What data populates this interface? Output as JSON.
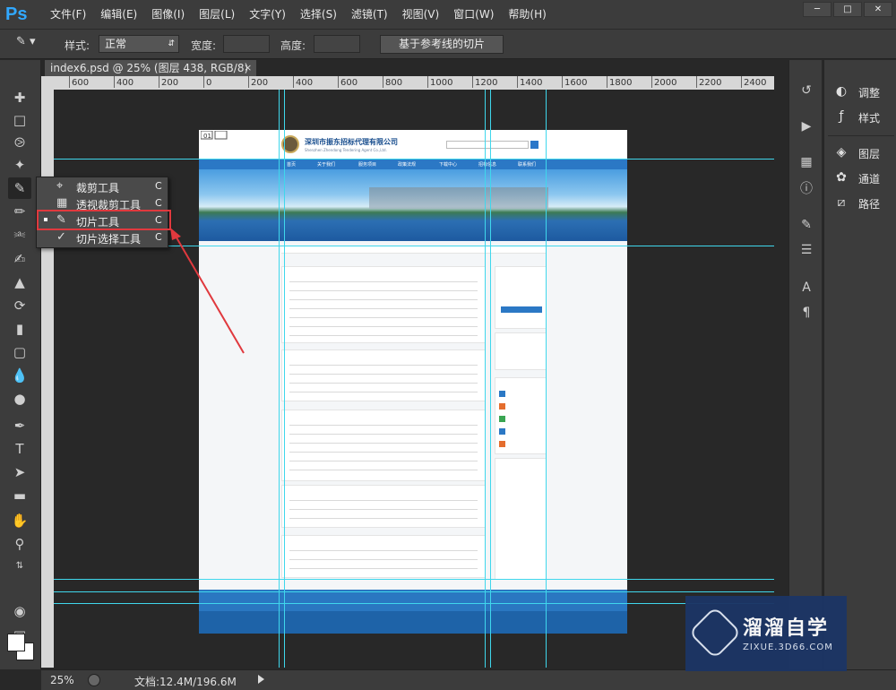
{
  "app": {
    "logo": "Ps",
    "menu": [
      "文件(F)",
      "编辑(E)",
      "图像(I)",
      "图层(L)",
      "文字(Y)",
      "选择(S)",
      "滤镜(T)",
      "视图(V)",
      "窗口(W)",
      "帮助(H)"
    ],
    "window_controls": [
      "minimize",
      "maximize",
      "close"
    ]
  },
  "options_bar": {
    "style_label": "样式:",
    "style_value": "正常",
    "width_label": "宽度:",
    "width_value": "",
    "height_label": "高度:",
    "height_value": "",
    "guides_slice_button": "基于参考线的切片"
  },
  "document": {
    "tab_title": "index6.psd @ 25% (图层 438, RGB/8) *",
    "tab_close": "×"
  },
  "ruler": {
    "ticks": [
      "600",
      "400",
      "200",
      "0",
      "200",
      "400",
      "600",
      "800",
      "1000",
      "1200",
      "1400",
      "1600",
      "1800",
      "2000",
      "2200",
      "2400"
    ]
  },
  "flyout": {
    "items": [
      {
        "icon": "crop-icon",
        "label": "裁剪工具",
        "shortcut": "C",
        "selected": false
      },
      {
        "icon": "perspective-crop-icon",
        "label": "透视裁剪工具",
        "shortcut": "C",
        "selected": false
      },
      {
        "icon": "slice-icon",
        "label": "切片工具",
        "shortcut": "C",
        "selected": true
      },
      {
        "icon": "slice-select-icon",
        "label": "切片选择工具",
        "shortcut": "C",
        "selected": false
      }
    ]
  },
  "tools": [
    "move-tool",
    "marquee-tool",
    "lasso-tool",
    "magic-wand-tool",
    "slice-tool",
    "eyedropper-tool",
    "healing-brush-tool",
    "brush-tool",
    "clone-stamp-tool",
    "history-brush-tool",
    "eraser-tool",
    "gradient-tool",
    "blur-tool",
    "dodge-tool",
    "pen-tool",
    "type-tool",
    "path-selection-tool",
    "rectangle-tool",
    "hand-tool",
    "zoom-tool"
  ],
  "panels": {
    "items": [
      {
        "icon": "adjustments-icon",
        "label": "调整"
      },
      {
        "icon": "styles-icon",
        "label": "样式"
      },
      {
        "icon": "layers-icon",
        "label": "图层"
      },
      {
        "icon": "channels-icon",
        "label": "通道"
      },
      {
        "icon": "paths-icon",
        "label": "路径"
      }
    ]
  },
  "status": {
    "zoom": "25%",
    "doc_size": "文档:12.4M/196.6M"
  },
  "website": {
    "company_cn": "深圳市振东招标代理有限公司",
    "company_en": "Shenzhen Zhendong Tendering Agent Co.,Ltd.",
    "nav": [
      "首页",
      "关于我们",
      "服务项目",
      "政策法规",
      "下载中心",
      "招标信息",
      "联系我们"
    ]
  },
  "watermark": {
    "title": "溜溜自学",
    "subtitle": "ZIXUE.3D66.COM"
  },
  "colors": {
    "guide": "#3fd7ec",
    "highlight": "#e0393e",
    "ps_blue": "#31a8ff"
  }
}
